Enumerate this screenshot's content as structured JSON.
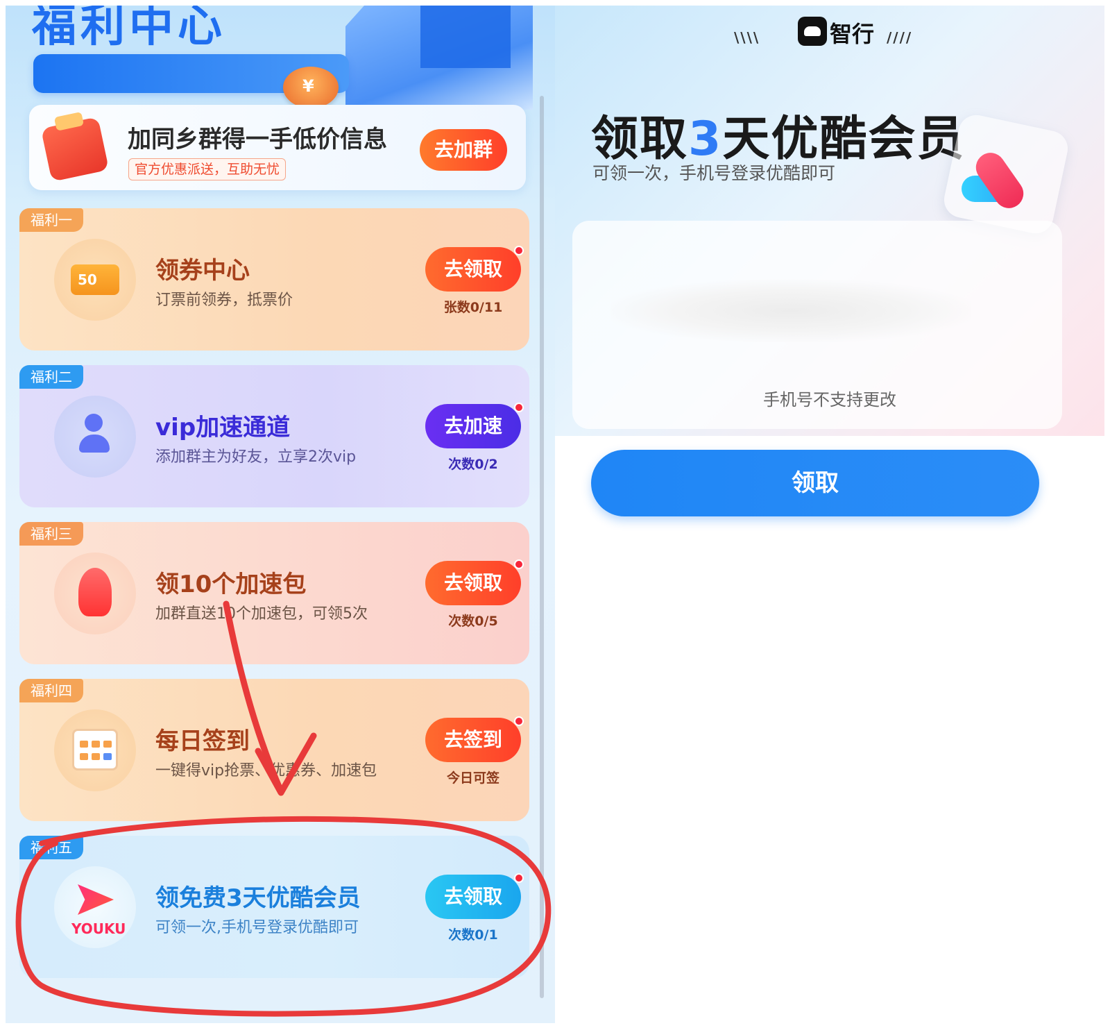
{
  "left": {
    "header_title": "福利中心",
    "coin_symbol": "¥",
    "group": {
      "title": "加同乡群得一手低价信息",
      "tag": "官方优惠派送，互助无忧",
      "button": "去加群"
    },
    "cards": [
      {
        "tag": "福利一",
        "icon_text": "50",
        "title": "领券中心",
        "desc": "订票前领券，抵票价",
        "button": "去领取",
        "count": "张数0/11"
      },
      {
        "tag": "福利二",
        "title": "vip加速通道",
        "desc": "添加群主为好友，立享2次vip",
        "button": "去加速",
        "count": "次数0/2"
      },
      {
        "tag": "福利三",
        "title": "领10个加速包",
        "desc": "加群直送10个加速包，可领5次",
        "button": "去领取",
        "count": "次数0/5"
      },
      {
        "tag": "福利四",
        "title": "每日签到",
        "desc": "一键得vip抢票、优惠券、加速包",
        "button": "去签到",
        "count": "今日可签"
      },
      {
        "tag": "福利五",
        "icon_text": "YOUKU",
        "title": "领免费3天优酷会员",
        "desc": "可领一次,手机号登录优酷即可",
        "button": "去领取",
        "count": "次数0/1"
      }
    ]
  },
  "right": {
    "brand_left_marks": "\\\\\\\\",
    "brand_name": "智行",
    "brand_right_marks": "////",
    "title_prefix": "领取",
    "title_highlight": "3",
    "title_suffix": "天优酷会员",
    "subtitle": "可领一次，手机号登录优酷即可",
    "phone_note": "手机号不支持更改",
    "claim_button": "领取"
  },
  "colors": {
    "primary_blue": "#2b8df7",
    "orange_btn": "#ff4a2a",
    "purple_btn": "#5b2df0",
    "cyan_btn": "#1fb6f0",
    "annotation_red": "#e83a3a"
  }
}
